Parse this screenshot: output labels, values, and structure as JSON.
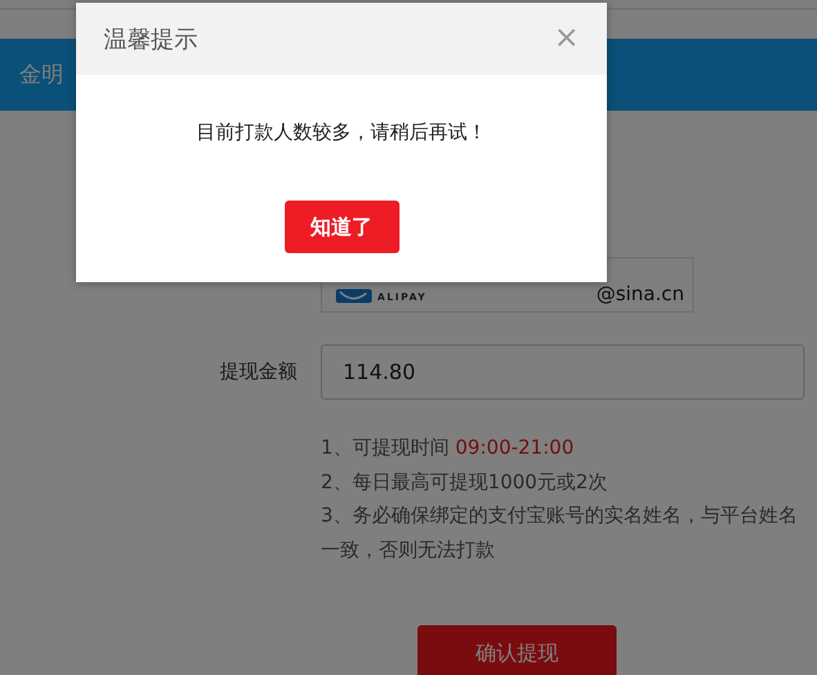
{
  "page": {
    "header_title": "金明"
  },
  "form": {
    "account_logo": "ALIPAY",
    "account_email": "@sina.cn",
    "amount_label": "提现金额",
    "amount_value": "114.80",
    "notes": [
      {
        "text": "1、可提现时间",
        "highlight": "09:00-21:00"
      },
      {
        "text": "2、每日最高可提现1000元或2次"
      },
      {
        "text": "3、务必确保绑定的支付宝账号的实名姓名，与平台姓名一致，否则无法打款"
      }
    ],
    "submit": "确认提现"
  },
  "dialog": {
    "title": "温馨提示",
    "close": "×",
    "message": "目前打款人数较多，请稍后再试！",
    "button": "知道了"
  }
}
